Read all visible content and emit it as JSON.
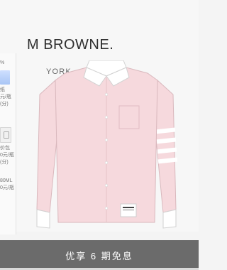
{
  "header": {
    "brand_partial": "M BROWNE.",
    "location_partial": "YORK"
  },
  "left_panel": {
    "items": [
      {
        "text": "%"
      },
      {
        "text": "纸"
      },
      {
        "text": "元/瓶"
      },
      {
        "text": "(分)"
      },
      {
        "text": "价包"
      },
      {
        "text": "0元/瓶"
      },
      {
        "text": "(分)"
      },
      {
        "text": "80ML"
      },
      {
        "text": "0元/瓶"
      }
    ]
  },
  "product": {
    "icon": "pink-oxford-shirt-image",
    "colors": {
      "shirt": "#f6d9dd",
      "collar": "#ffffff",
      "stripe": "#ffffff"
    }
  },
  "promo": {
    "text": "优享 6 期免息"
  }
}
